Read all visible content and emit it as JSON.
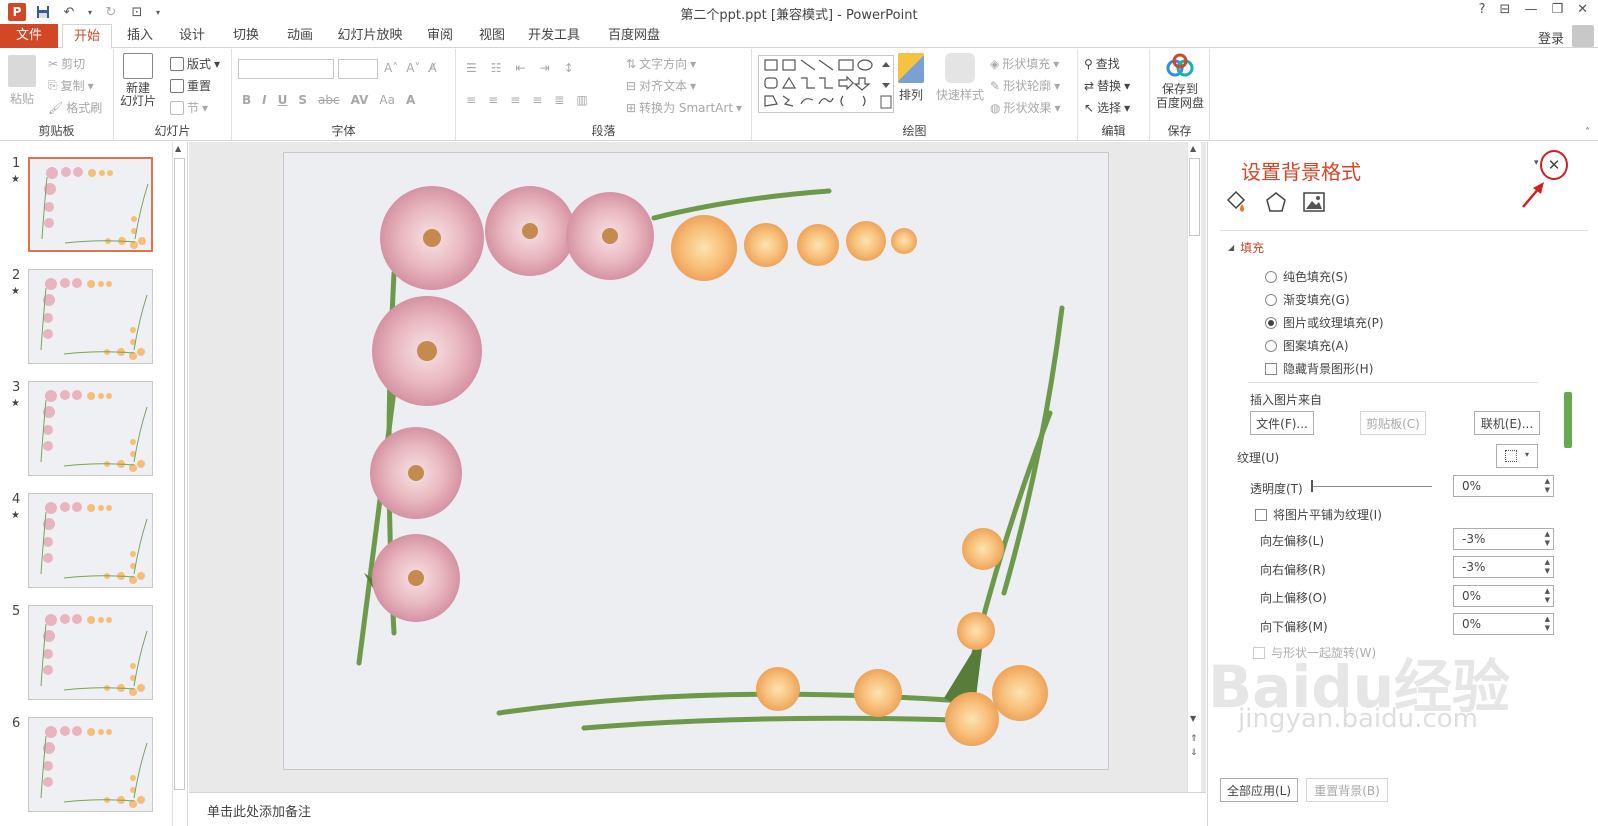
{
  "titlebar": {
    "title": "第二个ppt.ppt [兼容模式] - PowerPoint",
    "app_icon": "P"
  },
  "tabs": {
    "file": "文件",
    "home": "开始",
    "insert": "插入",
    "design": "设计",
    "transitions": "切换",
    "animations": "动画",
    "slideshow": "幻灯片放映",
    "review": "审阅",
    "view": "视图",
    "developer": "开发工具",
    "baidu": "百度网盘"
  },
  "account": {
    "login": "登录"
  },
  "ribbon": {
    "clipboard": {
      "paste": "粘贴",
      "cut": "剪切",
      "copy": "复制",
      "format_painter": "格式刷",
      "label": "剪贴板"
    },
    "slides": {
      "new_slide": "新建\n幻灯片",
      "layout": "版式",
      "reset": "重置",
      "section": "节",
      "label": "幻灯片"
    },
    "font": {
      "label": "字体"
    },
    "paragraph": {
      "text_direction": "文字方向",
      "align_text": "对齐文本",
      "smartart": "转换为 SmartArt",
      "label": "段落"
    },
    "drawing": {
      "arrange": "排列",
      "quick_styles": "快速样式",
      "shape_fill": "形状填充",
      "shape_outline": "形状轮廓",
      "shape_effects": "形状效果",
      "label": "绘图"
    },
    "editing": {
      "find": "查找",
      "replace": "替换",
      "select": "选择",
      "label": "编辑"
    },
    "save": {
      "save_baidu": "保存到\n百度网盘",
      "label": "保存"
    }
  },
  "slides": [
    {
      "num": "1",
      "star": "★"
    },
    {
      "num": "2",
      "star": "★"
    },
    {
      "num": "3",
      "star": "★"
    },
    {
      "num": "4",
      "star": "★"
    },
    {
      "num": "5",
      "star": ""
    },
    {
      "num": "6",
      "star": ""
    }
  ],
  "notes": {
    "placeholder": "单击此处添加备注"
  },
  "pane": {
    "title": "设置背景格式",
    "section": "填充",
    "options": {
      "solid": "纯色填充(S)",
      "gradient": "渐变填充(G)",
      "picture": "图片或纹理填充(P)",
      "pattern": "图案填充(A)",
      "hide_graphics": "隐藏背景图形(H)"
    },
    "insert_from": "插入图片来自",
    "file_btn": "文件(F)...",
    "clipboard_btn": "剪贴板(C)",
    "online_btn": "联机(E)...",
    "texture": "纹理(U)",
    "transparency": {
      "label": "透明度(T)",
      "value": "0%"
    },
    "tile": "将图片平铺为纹理(I)",
    "offset_left": {
      "label": "向左偏移(L)",
      "value": "-3%"
    },
    "offset_right": {
      "label": "向右偏移(R)",
      "value": "-3%"
    },
    "offset_top": {
      "label": "向上偏移(O)",
      "value": "0%"
    },
    "offset_bottom": {
      "label": "向下偏移(M)",
      "value": "0%"
    },
    "rotate_with_shape": "与形状一起旋转(W)",
    "apply_all": "全部应用(L)",
    "reset_bg": "重置背景(B)"
  },
  "watermark": {
    "brand": "Baidu经验",
    "url": "jingyan.baidu.com"
  }
}
